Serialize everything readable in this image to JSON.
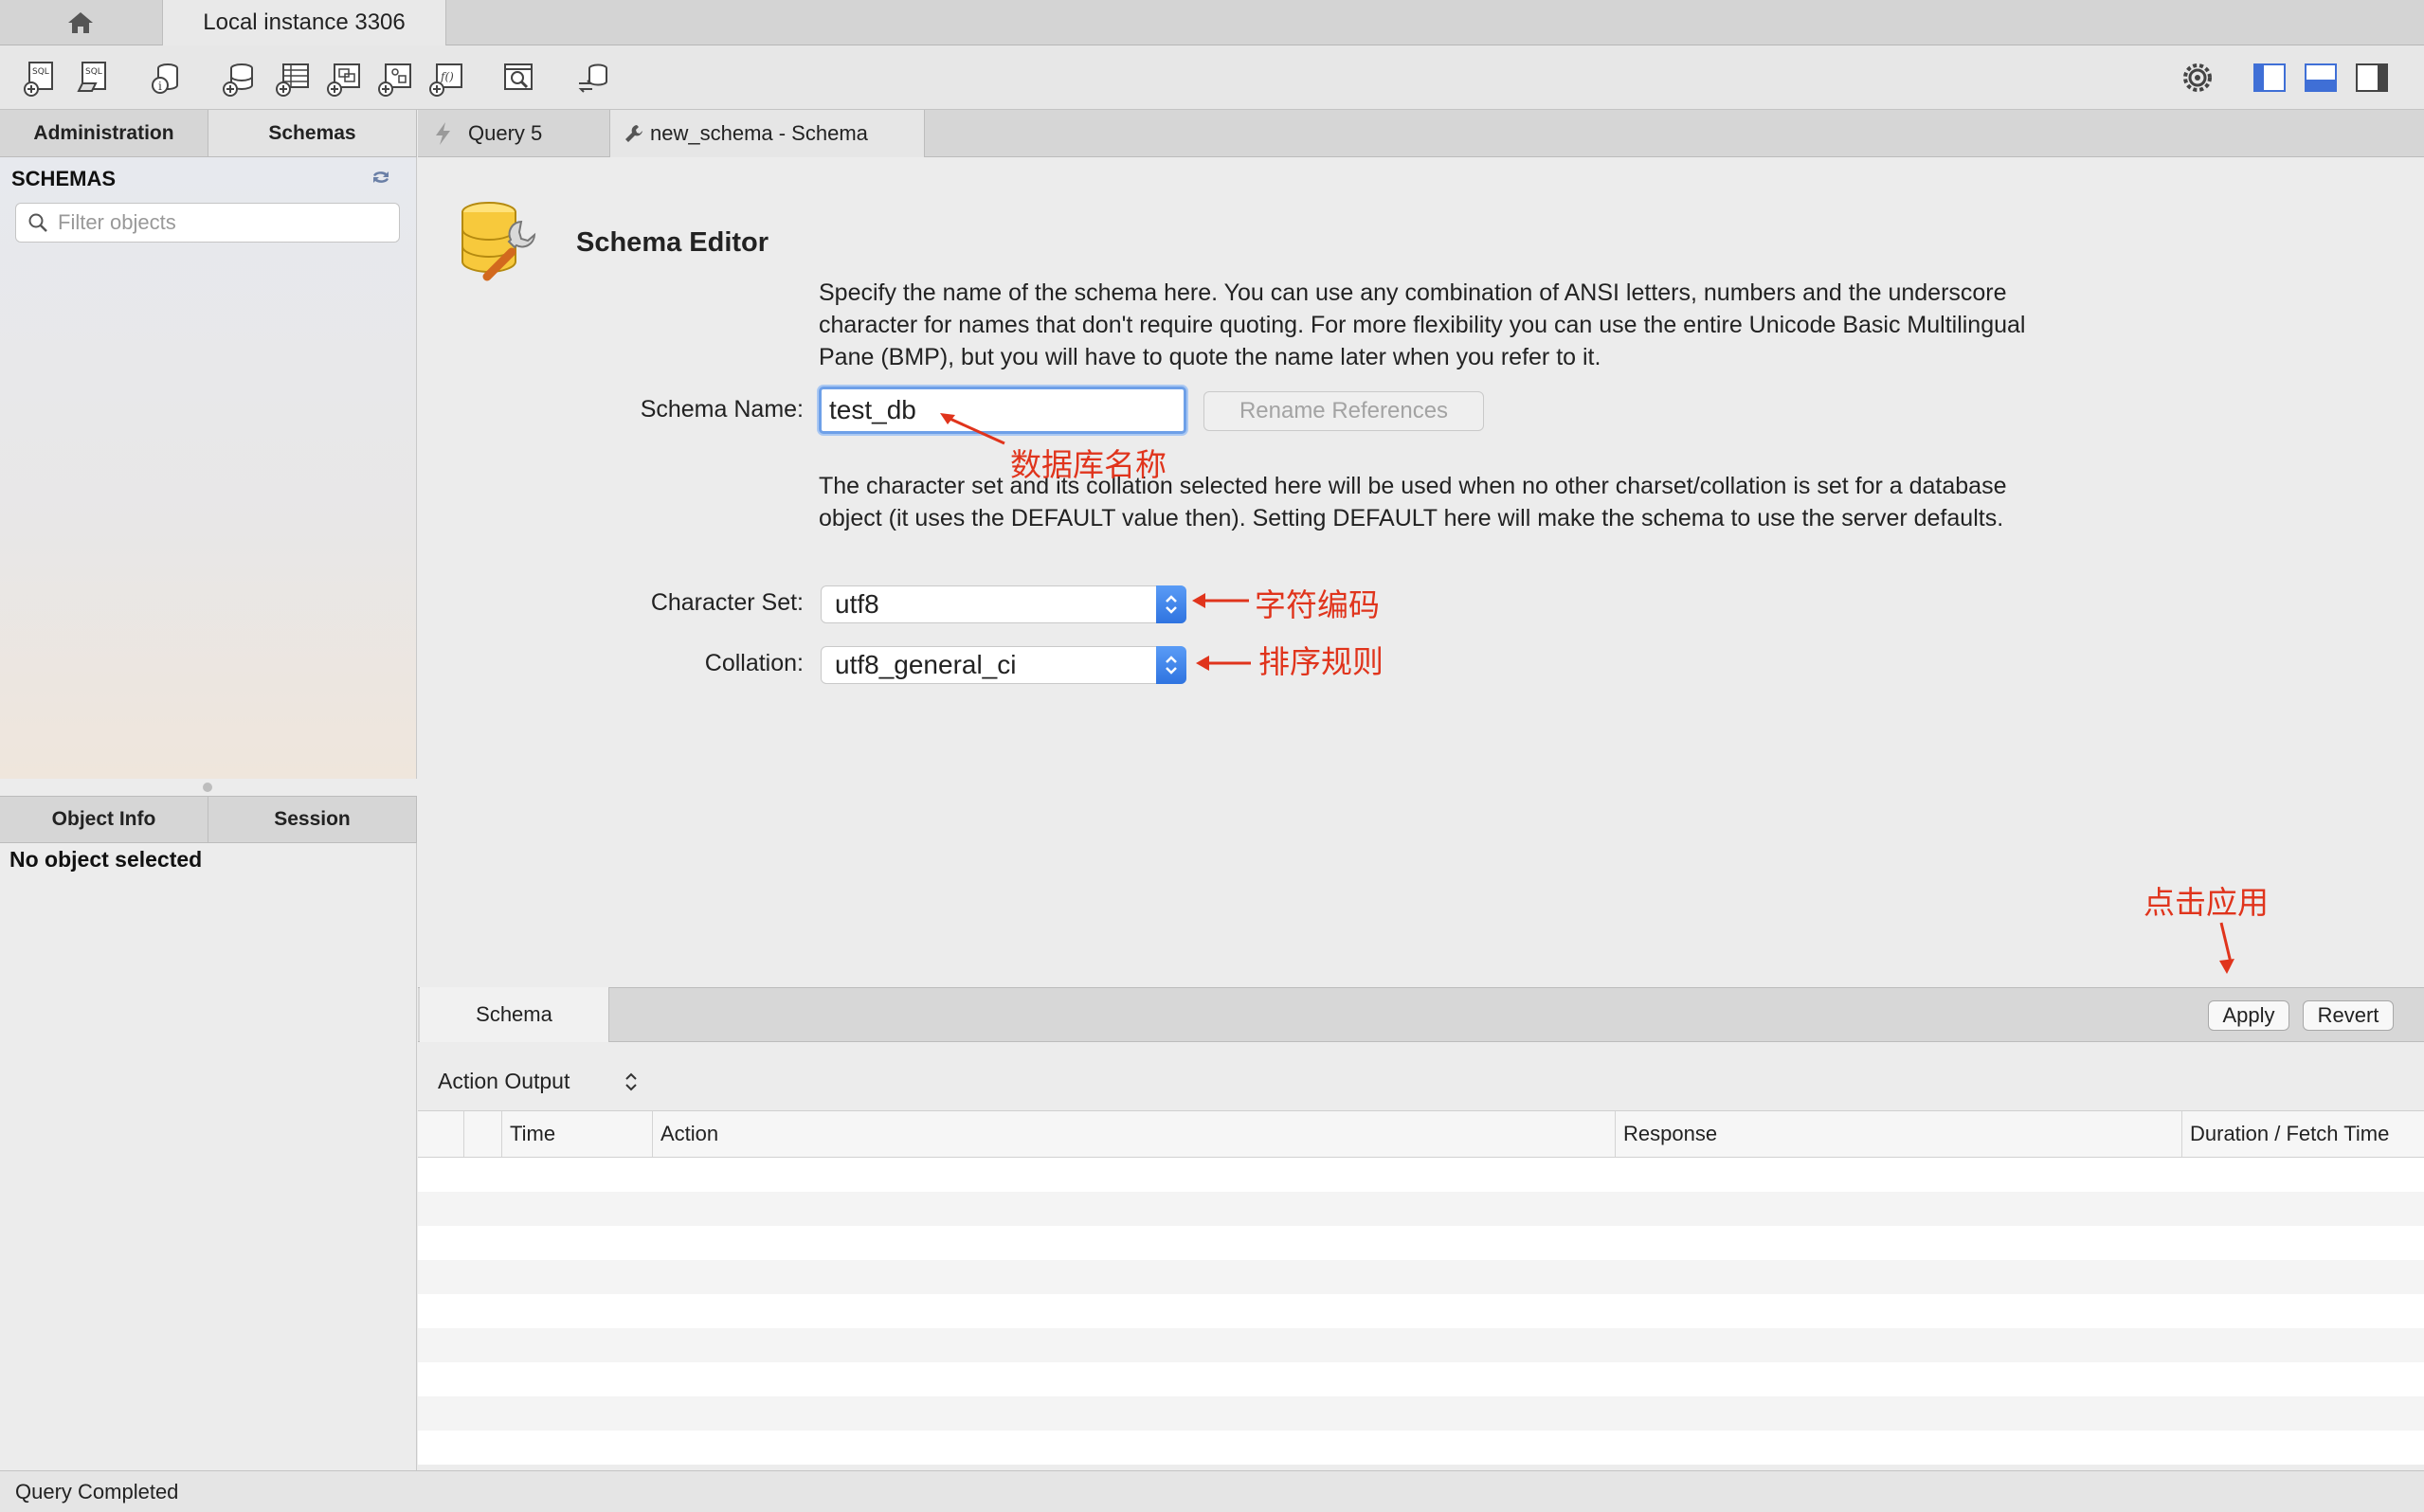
{
  "window": {
    "connection_tab": "Local instance 3306"
  },
  "toolbar": {
    "icons": [
      "new-sql-tab-icon",
      "open-sql-script-icon",
      "inspector-icon",
      "create-schema-icon",
      "create-table-icon",
      "create-view-icon",
      "create-procedure-icon",
      "create-function-icon",
      "search-table-data-icon",
      "reconnect-icon"
    ],
    "right_icons": [
      "settings-icon",
      "toggle-sidebar-icon",
      "toggle-output-icon",
      "toggle-secondary-sidebar-icon"
    ]
  },
  "sidebar": {
    "tabs": [
      "Administration",
      "Schemas"
    ],
    "active_tab": "Schemas",
    "header": "SCHEMAS",
    "filter_placeholder": "Filter objects",
    "info_tabs": [
      "Object Info",
      "Session"
    ],
    "no_object": "No object selected"
  },
  "editor_tabs": [
    {
      "label": "Query 5",
      "icon": "lightning-icon"
    },
    {
      "label": "new_schema - Schema",
      "icon": "wrench-icon"
    }
  ],
  "schema_editor": {
    "title": "Schema Editor",
    "name_description": "Specify the name of the schema here. You can use any combination of ANSI letters, numbers and the underscore character for names that don't require quoting. For more flexibility you can use the entire Unicode Basic Multilingual Pane (BMP), but you will have to quote the name later when you refer to it.",
    "name_label": "Schema Name:",
    "name_value": "test_db",
    "rename_button": "Rename References",
    "charset_description": "The character set and its collation selected here will be used when no other charset/collation is set for a database object (it uses the DEFAULT value then). Setting DEFAULT here will make the schema to use the server defaults.",
    "charset_label": "Character Set:",
    "charset_value": "utf8",
    "collation_label": "Collation:",
    "collation_value": "utf8_general_ci"
  },
  "annotations": {
    "name": "数据库名称",
    "charset": "字符编码",
    "collation": "排序规则",
    "apply": "点击应用",
    "color": "#e0341c"
  },
  "bottom": {
    "tab": "Schema",
    "apply": "Apply",
    "revert": "Revert"
  },
  "output": {
    "selector": "Action Output",
    "columns": [
      "Time",
      "Action",
      "Response",
      "Duration / Fetch Time"
    ]
  },
  "status": "Query Completed"
}
